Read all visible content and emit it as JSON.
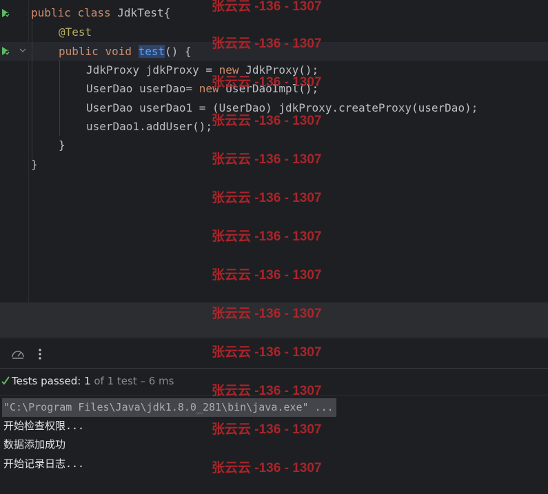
{
  "editor": {
    "lines": [
      {
        "parts": [
          [
            "kw",
            "public "
          ],
          [
            "kw",
            "class "
          ],
          [
            "",
            "JdkTest{"
          ]
        ]
      },
      {
        "parts": [
          [
            "ann",
            "@Test"
          ]
        ]
      },
      {
        "parts": [
          [
            "kw",
            "public "
          ],
          [
            "kw",
            "void "
          ],
          [
            "fn-hl",
            "test"
          ],
          [
            "",
            "() {"
          ]
        ]
      },
      {
        "parts": [
          [
            "",
            "JdkProxy jdkProxy = "
          ],
          [
            "kw",
            "new "
          ],
          [
            "",
            "JdkProxy();"
          ]
        ]
      },
      {
        "parts": [
          [
            "",
            "UserDao userDao= "
          ],
          [
            "kw",
            "new "
          ],
          [
            "",
            "UserDaoImpl();"
          ]
        ]
      },
      {
        "parts": [
          [
            "",
            "UserDao userDao1 = (UserDao) jdkProxy.createProxy(userDao);"
          ]
        ]
      },
      {
        "parts": [
          [
            "",
            "userDao1.addUser();"
          ]
        ]
      },
      {
        "parts": [
          [
            "",
            "}"
          ]
        ]
      },
      {
        "parts": [
          [
            "",
            "}"
          ]
        ]
      }
    ]
  },
  "run_panel": {
    "status_label": "Tests passed: ",
    "status_count": "1",
    "status_rest": " of 1 test – 6 ms",
    "console_lines": [
      "\"C:\\Program Files\\Java\\jdk1.8.0_281\\bin\\java.exe\" ...",
      "开始检查权限...",
      "数据添加成功",
      "开始记录日志..."
    ]
  },
  "watermark": {
    "text": "张云云 -136 - 1307"
  },
  "colors": {
    "background": "#1e1f22",
    "keyword": "#cf8e6d",
    "annotation": "#b3ae60",
    "method": "#56a8f5",
    "pass_green": "#5fb865",
    "watermark_red": "#b4262b"
  }
}
